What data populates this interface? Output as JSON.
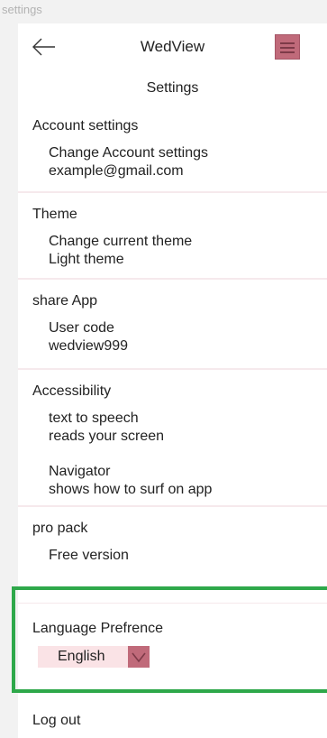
{
  "window": {
    "label": "settings"
  },
  "header": {
    "app_title": "WedView",
    "screen_title": "Settings"
  },
  "sections": {
    "account": {
      "title": "Account settings",
      "action": "Change Account settings",
      "value": "example@gmail.com"
    },
    "theme": {
      "title": "Theme",
      "action": "Change current theme",
      "value": "Light theme"
    },
    "share": {
      "title": "share App",
      "action": "User code",
      "value": "wedview999"
    },
    "accessibility": {
      "title": "Accessibility",
      "tts_title": "text to speech",
      "tts_desc": "reads your screen",
      "nav_title": "Navigator",
      "nav_desc": "shows how to surf on app"
    },
    "pro": {
      "title": "pro pack",
      "value": "Free version"
    }
  },
  "language": {
    "title": "Language Prefrence",
    "selected": "English"
  },
  "footer": {
    "logout": "Log out"
  },
  "colors": {
    "accent": "#c06a7a",
    "select_bg": "#fae3e6",
    "highlight_box": "#2ea84a",
    "divider": "#f6e9ec"
  },
  "icons": {
    "back": "arrow-left-icon",
    "menu": "hamburger-menu-icon",
    "dropdown": "chevron-down-icon"
  }
}
